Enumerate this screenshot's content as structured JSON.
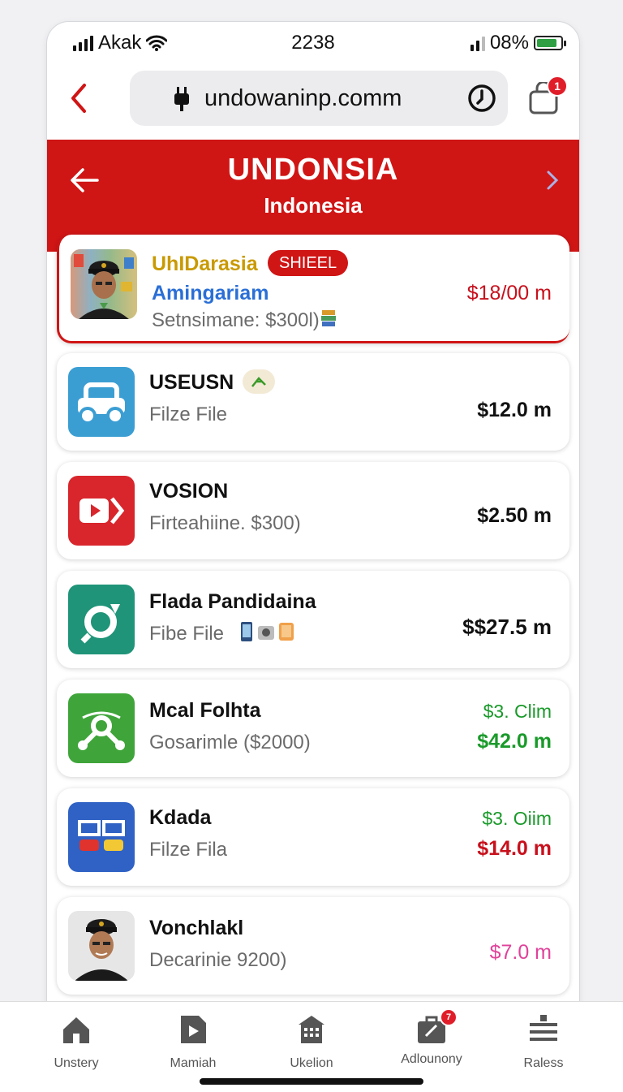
{
  "status": {
    "carrier": "Akak",
    "time": "2238",
    "battery": "08%"
  },
  "browser": {
    "url": "undowaninp.comm",
    "cart_badge": "1"
  },
  "banner": {
    "title": "UNDONSIA",
    "subtitle": "Indonesia"
  },
  "items": [
    {
      "brand": "UhIDarasia",
      "badge": "SHIEEL",
      "title": "Amingariam",
      "subtitle": "Setnsimane: $300l)",
      "price": "$18/00 m"
    },
    {
      "title": "USEUSN",
      "subtitle": "Filze File",
      "price": "$12.0 m"
    },
    {
      "title": "VOSION",
      "subtitle": "Firteahiine. $300)",
      "price": "$2.50 m"
    },
    {
      "title": "Flada Pandidaina",
      "subtitle": "Fibe File",
      "price": "$$27.5 m"
    },
    {
      "title": "Mcal Folhta",
      "subtitle": "Gosarimle ($2000)",
      "price_top": "$3. Clim",
      "price": "$42.0 m"
    },
    {
      "title": "Kdada",
      "subtitle": "Filze Fila",
      "price_top": "$3. Oiim",
      "price": "$14.0 m"
    },
    {
      "title": "Vonchlakl",
      "subtitle": "Decarinie 9200)",
      "price": "$7.0 m"
    }
  ],
  "tabs": [
    {
      "label": "Unstery",
      "icon": "home-icon"
    },
    {
      "label": "Mamiah",
      "icon": "play-document-icon"
    },
    {
      "label": "Ukelion",
      "icon": "building-icon"
    },
    {
      "label": "Adlounony",
      "icon": "briefcase-icon",
      "badge": "7"
    },
    {
      "label": "Raless",
      "icon": "stack-icon"
    }
  ],
  "colors": {
    "brand_red": "#d01515",
    "green_price": "#1a9a2a",
    "red_price": "#c8101c",
    "pink_price": "#e0429a",
    "blue_title": "#2a6fd6",
    "gold_brand": "#c99a00"
  }
}
